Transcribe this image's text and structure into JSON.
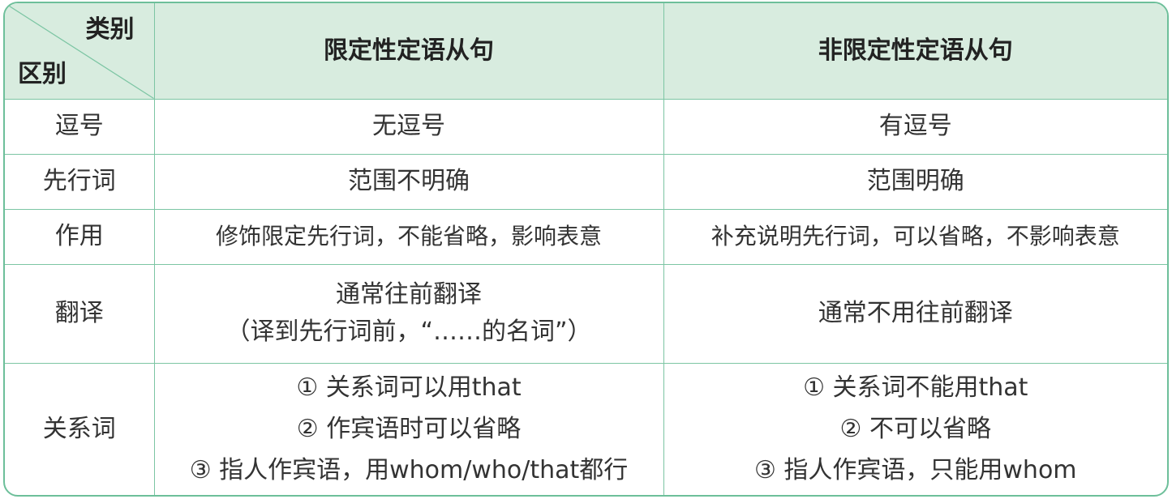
{
  "header": {
    "corner_category": "类别",
    "corner_difference": "区别",
    "col_restrictive": "限定性定语从句",
    "col_nonrestrictive": "非限定性定语从句"
  },
  "rows": [
    {
      "label": "逗号",
      "restrictive": [
        "无逗号"
      ],
      "nonrestrictive": [
        "有逗号"
      ]
    },
    {
      "label": "先行词",
      "restrictive": [
        "范围不明确"
      ],
      "nonrestrictive": [
        "范围明确"
      ]
    },
    {
      "label": "作用",
      "restrictive": [
        "修饰限定先行词，不能省略，影响表意"
      ],
      "nonrestrictive": [
        "补充说明先行词，可以省略，不影响表意"
      ]
    },
    {
      "label": "翻译",
      "restrictive": [
        "通常往前翻译",
        "（译到先行词前，“……的名词”）"
      ],
      "nonrestrictive": [
        "通常不用往前翻译"
      ]
    },
    {
      "label": "关系词",
      "restrictive": [
        "① 关系词可以用that",
        "② 作宾语时可以省略",
        "③ 指人作宾语，用whom/who/that都行"
      ],
      "nonrestrictive": [
        "① 关系词不能用that",
        "② 不可以省略",
        "③ 指人作宾语，只能用whom"
      ]
    }
  ],
  "colors": {
    "border": "#7cc5a3",
    "header_bg": "#d8ecdf"
  }
}
